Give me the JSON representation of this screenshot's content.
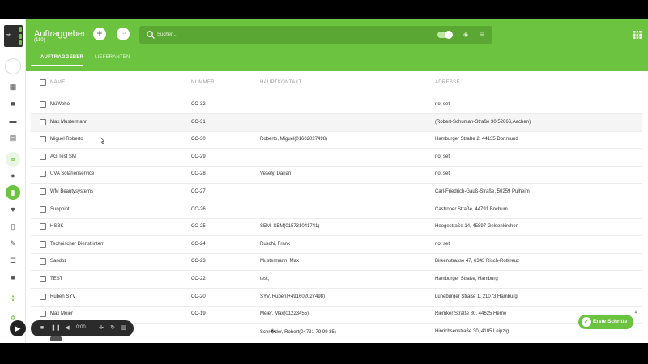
{
  "header": {
    "title": "Auftraggeber",
    "count": "(110)",
    "add_label": "+",
    "more_label": "···",
    "search_placeholder": "Suchen..."
  },
  "tabs": [
    {
      "label": "AUFTRAGGEBER",
      "active": true
    },
    {
      "label": "LIEFERANTEN",
      "active": false
    }
  ],
  "table": {
    "columns": [
      "NAME",
      "NUMMER",
      "HAUPTKONTAKT",
      "ADRESSE"
    ],
    "rows": [
      {
        "name": "MüWoho",
        "number": "CO-32",
        "contact": "",
        "address": "not set"
      },
      {
        "name": "Max Mustermann",
        "number": "CO-31",
        "contact": "",
        "address": "(Robert-Schuman-Straße 30,52066,Aachen)"
      },
      {
        "name": "Miguel Roberto",
        "number": "CO-30",
        "contact": "Roberto, Miguel(01602027498)",
        "address": "Hamburger Straße 2, 44135 Dortmund"
      },
      {
        "name": "AG Test SM",
        "number": "CO-29",
        "contact": "",
        "address": "not set"
      },
      {
        "name": "UVA Solarienservice",
        "number": "CO-28",
        "contact": "Vesely, Darian",
        "address": "not set"
      },
      {
        "name": "WM Beautysystems",
        "number": "CO-27",
        "contact": "",
        "address": "Carl-Friedrich-Gauß-Straße, 50259 Pulheim"
      },
      {
        "name": "Sunpoint",
        "number": "CO-26",
        "contact": "",
        "address": "Castroper Straße, 44791 Bochum"
      },
      {
        "name": "HSBK",
        "number": "CO-25",
        "contact": "SEM, SEM(015731041741)",
        "address": "Heegestraße 14, 45897 Gelsenkirchen"
      },
      {
        "name": "Technischer Dienst intern",
        "number": "CO-24",
        "contact": "Ruschi, Frank",
        "address": "not set"
      },
      {
        "name": "Sandoz",
        "number": "CO-23",
        "contact": "Mustermann, Max",
        "address": "Birkenstrasse 47, 6343 Risch-Rotkreuz"
      },
      {
        "name": "TEST",
        "number": "CO-22",
        "contact": "test,",
        "address": "Hamburger Straße, Hamburg"
      },
      {
        "name": "Ruben SYV",
        "number": "CO-20",
        "contact": "SYV, Ruben(+491602027498)",
        "address": "Lüneburger Straße 1, 21073 Hamburg"
      },
      {
        "name": "Max Meier",
        "number": "CO-19",
        "contact": "Meier, Max(01223455)",
        "address": "Riemker Straße 80, 44625 Herne"
      },
      {
        "name": "",
        "number": "",
        "contact": "Schr�der, Robert(04731 79 99 35)",
        "address": "Hinrichsenstraße 30, 4105 Leipzig"
      }
    ]
  },
  "recorder": {
    "time": "0:00"
  },
  "help": {
    "label": "Erste Schritte",
    "badge": "4"
  },
  "colors": {
    "accent": "#6cc33f",
    "search_bg": "#5aa733"
  }
}
